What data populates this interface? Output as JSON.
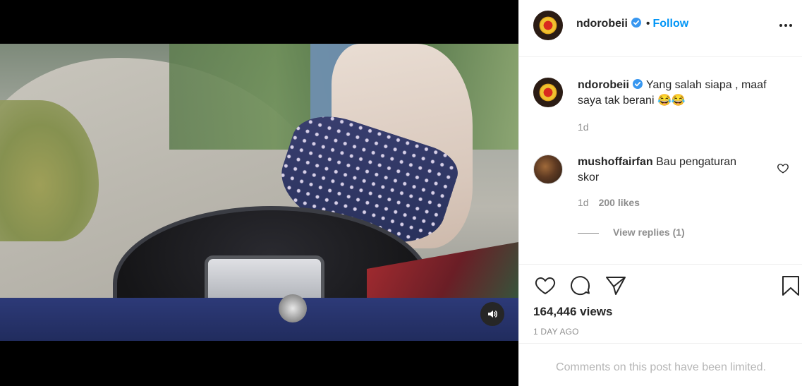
{
  "post": {
    "username": "ndorobeii",
    "follow_separator": "•",
    "follow_label": "Follow",
    "more_icon": "more-options-icon",
    "verified_icon": "verified-badge-icon",
    "brand_blue": "#0095f6"
  },
  "video": {
    "mute_icon": "speaker-icon",
    "background": "#000000"
  },
  "caption": {
    "username": "ndorobeii",
    "text": "Yang salah siapa , maaf saya tak berani 😂😂",
    "time": "1d"
  },
  "comments": [
    {
      "username": "mushoffairfan",
      "text": "Bau pengaturan skor",
      "time": "1d",
      "likes": "200 likes",
      "view_replies": "View replies (1)"
    }
  ],
  "actions": {
    "like_icon": "heart-icon",
    "comment_icon": "comment-bubble-icon",
    "share_icon": "paper-plane-icon",
    "save_icon": "bookmark-icon"
  },
  "stats": {
    "views": "164,446 views",
    "date": "1 DAY AGO"
  },
  "footer": {
    "limited_text": "Comments on this post have been limited."
  }
}
